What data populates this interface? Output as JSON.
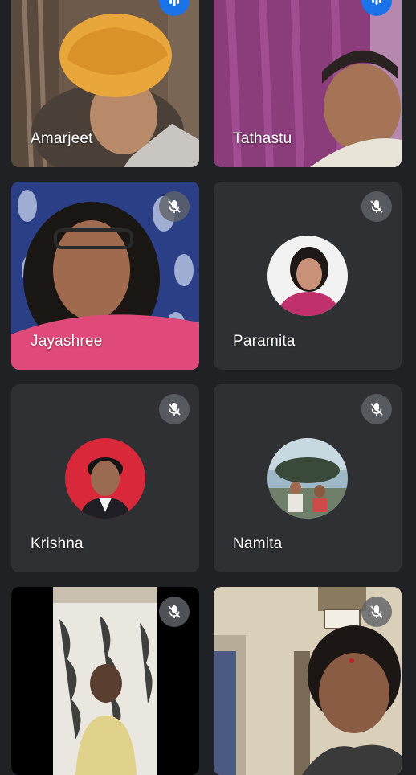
{
  "participants": [
    {
      "name": "Amarjeet",
      "mic_state": "speaking"
    },
    {
      "name": "Tathastu",
      "mic_state": "speaking"
    },
    {
      "name": "Jayashree",
      "mic_state": "muted"
    },
    {
      "name": "Paramita",
      "mic_state": "muted"
    },
    {
      "name": "Krishna",
      "mic_state": "muted"
    },
    {
      "name": "Namita",
      "mic_state": "muted"
    },
    {
      "name": "",
      "mic_state": "muted"
    },
    {
      "name": "",
      "mic_state": "muted"
    }
  ],
  "colors": {
    "background": "#202124",
    "tile": "#2f3033",
    "active_border": "#5f8dd3",
    "speaking": "#1a73e8",
    "muted_badge": "#5f6368"
  },
  "icons": {
    "speaking": "audio-level-icon",
    "muted": "mic-off-icon"
  }
}
